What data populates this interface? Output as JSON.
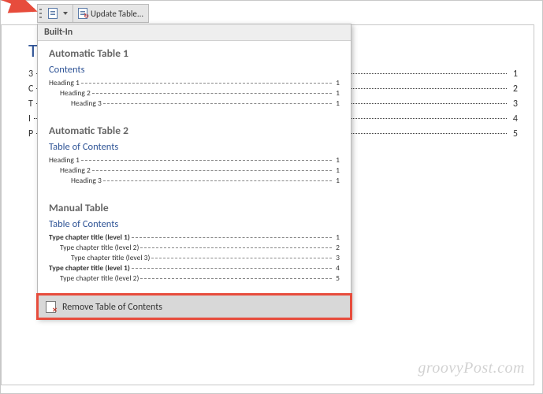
{
  "toolbar": {
    "update_label": "Update Table..."
  },
  "doc": {
    "title": "T",
    "rows": [
      {
        "left": "3",
        "page": "1"
      },
      {
        "left": "C",
        "page": "2"
      },
      {
        "left": "T",
        "page": "3"
      },
      {
        "left": "I",
        "page": "4"
      },
      {
        "left": "P",
        "page": "5"
      }
    ]
  },
  "dropdown": {
    "section_label": "Built-In",
    "styles": [
      {
        "name": "Automatic Table 1",
        "title": "Contents",
        "bold_title": false,
        "lines": [
          {
            "label": "Heading 1",
            "indent": 0,
            "page": "1",
            "bold": false
          },
          {
            "label": "Heading 2",
            "indent": 1,
            "page": "1",
            "bold": false
          },
          {
            "label": "Heading 3",
            "indent": 2,
            "page": "1",
            "bold": false
          }
        ]
      },
      {
        "name": "Automatic Table 2",
        "title": "Table of Contents",
        "bold_title": false,
        "lines": [
          {
            "label": "Heading 1",
            "indent": 0,
            "page": "1",
            "bold": false
          },
          {
            "label": "Heading 2",
            "indent": 1,
            "page": "1",
            "bold": false
          },
          {
            "label": "Heading 3",
            "indent": 2,
            "page": "1",
            "bold": false
          }
        ]
      },
      {
        "name": "Manual Table",
        "title": "Table of Contents",
        "bold_title": false,
        "lines": [
          {
            "label": "Type chapter title (level 1)",
            "indent": 0,
            "page": "1",
            "bold": true
          },
          {
            "label": "Type chapter title (level 2)",
            "indent": 1,
            "page": "2",
            "bold": false
          },
          {
            "label": "Type chapter title (level 3)",
            "indent": 2,
            "page": "3",
            "bold": false
          },
          {
            "label": "Type chapter title (level 1)",
            "indent": 0,
            "page": "4",
            "bold": true
          },
          {
            "label": "Type chapter title (level 2)",
            "indent": 1,
            "page": "5",
            "bold": false
          }
        ]
      }
    ],
    "remove_label": "Remove Table of Contents"
  },
  "watermark": "groovyPost.com"
}
